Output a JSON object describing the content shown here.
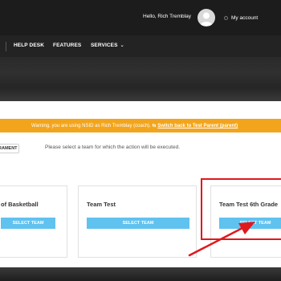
{
  "header": {
    "greeting": "Hello, Rich Tremblay",
    "account_label": "My account"
  },
  "nav": {
    "items": [
      "HELP DESK",
      "FEATURES",
      "SERVICES"
    ],
    "services_chevron": "⌄"
  },
  "warning": {
    "text": "Warning, you are using NSID as Rich Tremblay (coach).",
    "link_icon": "⇆",
    "link": "Switch back to Test Parent (parent)"
  },
  "tab_button_label": "RAMENT",
  "instruction": "Please select a team for which the action will be executed.",
  "teams": [
    {
      "name": "of Basketball",
      "button": "SELECT TEAM"
    },
    {
      "name": "Team Test",
      "button": "SELECT TEAM"
    },
    {
      "name": "Team Test 6th Grade",
      "button": "SELECT TEAM"
    }
  ],
  "colors": {
    "warning": "#f2a51c",
    "button": "#60c2ef",
    "highlight": "#e0191d"
  },
  "icons": {
    "avatar": "user-silhouette-icon",
    "account": "circle-icon",
    "switch": "swap-icon",
    "annotation": "arrow-icon"
  }
}
